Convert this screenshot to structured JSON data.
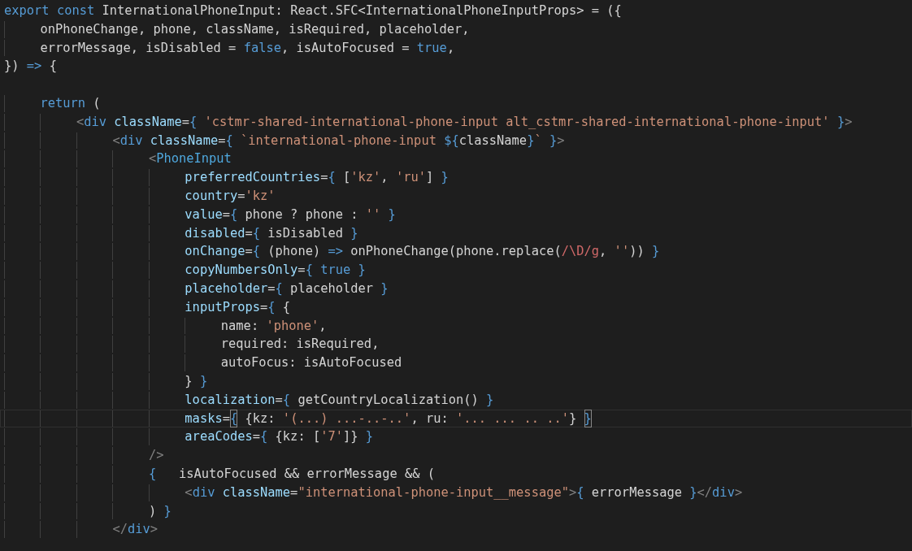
{
  "editor": {
    "lines": [
      {
        "current": false,
        "tokens": [
          {
            "kind": "keyword",
            "text": "export"
          },
          {
            "kind": "keyword",
            "text": " const"
          },
          {
            "kind": "plain",
            "text": " InternationalPhoneInput: React.SFC<InternationalPhoneInputProps> = ({"
          }
        ],
        "children": [
          {
            "current": false,
            "tokens": [
              {
                "kind": "plain",
                "text": "onPhoneChange, phone, className, isRequired, placeholder,"
              }
            ]
          },
          {
            "current": false,
            "tokens": [
              {
                "kind": "plain",
                "text": "errorMessage, isDisabled = "
              },
              {
                "kind": "keyword",
                "text": "false"
              },
              {
                "kind": "plain",
                "text": ", isAutoFocused = "
              },
              {
                "kind": "keyword",
                "text": "true"
              },
              {
                "kind": "plain",
                "text": ","
              }
            ]
          }
        ]
      },
      {
        "current": false,
        "tokens": [
          {
            "kind": "plain",
            "text": "}) "
          },
          {
            "kind": "keyword",
            "text": "=>"
          },
          {
            "kind": "plain",
            "text": " {"
          }
        ],
        "children": [
          {
            "current": false
          },
          {
            "current": false,
            "tokens": [
              {
                "kind": "keyword",
                "text": "return"
              },
              {
                "kind": "plain",
                "text": " ("
              }
            ],
            "children": [
              {
                "current": false,
                "tokens": [
                  {
                    "kind": "punct",
                    "text": "<"
                  },
                  {
                    "kind": "keyword",
                    "text": "div"
                  },
                  {
                    "kind": "attr",
                    "text": " className"
                  },
                  {
                    "kind": "plain",
                    "text": "="
                  },
                  {
                    "kind": "brace",
                    "text": "{"
                  },
                  {
                    "kind": "string",
                    "text": " 'cstmr-shared-international-phone-input alt_cstmr-shared-international-phone-input'"
                  },
                  {
                    "kind": "brace",
                    "text": " }"
                  },
                  {
                    "kind": "punct",
                    "text": ">"
                  }
                ],
                "children": [
                  {
                    "current": false,
                    "tokens": [
                      {
                        "kind": "punct",
                        "text": "<"
                      },
                      {
                        "kind": "keyword",
                        "text": "div"
                      },
                      {
                        "kind": "attr",
                        "text": " className"
                      },
                      {
                        "kind": "plain",
                        "text": "="
                      },
                      {
                        "kind": "brace",
                        "text": "{"
                      },
                      {
                        "kind": "string",
                        "text": " `international-phone-input "
                      },
                      {
                        "kind": "brace",
                        "text": "${"
                      },
                      {
                        "kind": "plain",
                        "text": "className"
                      },
                      {
                        "kind": "brace",
                        "text": "}"
                      },
                      {
                        "kind": "string",
                        "text": "`"
                      },
                      {
                        "kind": "brace",
                        "text": " }"
                      },
                      {
                        "kind": "punct",
                        "text": ">"
                      }
                    ],
                    "children": [
                      {
                        "current": false,
                        "tokens": [
                          {
                            "kind": "punct",
                            "text": "<"
                          },
                          {
                            "kind": "component",
                            "text": "PhoneInput"
                          }
                        ],
                        "children": [
                          {
                            "current": false,
                            "tokens": [
                              {
                                "kind": "attr",
                                "text": "preferredCountries"
                              },
                              {
                                "kind": "plain",
                                "text": "="
                              },
                              {
                                "kind": "brace",
                                "text": "{"
                              },
                              {
                                "kind": "plain",
                                "text": " ["
                              },
                              {
                                "kind": "string",
                                "text": "'kz'"
                              },
                              {
                                "kind": "plain",
                                "text": ", "
                              },
                              {
                                "kind": "string",
                                "text": "'ru'"
                              },
                              {
                                "kind": "plain",
                                "text": "]"
                              },
                              {
                                "kind": "brace",
                                "text": " }"
                              }
                            ]
                          },
                          {
                            "current": false,
                            "tokens": [
                              {
                                "kind": "attr",
                                "text": "country"
                              },
                              {
                                "kind": "plain",
                                "text": "="
                              },
                              {
                                "kind": "string",
                                "text": "'kz'"
                              }
                            ]
                          },
                          {
                            "current": false,
                            "tokens": [
                              {
                                "kind": "attr",
                                "text": "value"
                              },
                              {
                                "kind": "plain",
                                "text": "="
                              },
                              {
                                "kind": "brace",
                                "text": "{"
                              },
                              {
                                "kind": "plain",
                                "text": " phone ? phone : "
                              },
                              {
                                "kind": "string",
                                "text": "''"
                              },
                              {
                                "kind": "brace",
                                "text": " }"
                              }
                            ]
                          },
                          {
                            "current": false,
                            "tokens": [
                              {
                                "kind": "attr",
                                "text": "disabled"
                              },
                              {
                                "kind": "plain",
                                "text": "="
                              },
                              {
                                "kind": "brace",
                                "text": "{"
                              },
                              {
                                "kind": "plain",
                                "text": " isDisabled"
                              },
                              {
                                "kind": "brace",
                                "text": " }"
                              }
                            ]
                          },
                          {
                            "current": false,
                            "tokens": [
                              {
                                "kind": "attr",
                                "text": "onChange"
                              },
                              {
                                "kind": "plain",
                                "text": "="
                              },
                              {
                                "kind": "brace",
                                "text": "{"
                              },
                              {
                                "kind": "plain",
                                "text": " (phone) "
                              },
                              {
                                "kind": "keyword",
                                "text": "=>"
                              },
                              {
                                "kind": "plain",
                                "text": " onPhoneChange(phone.replace("
                              },
                              {
                                "kind": "regex",
                                "text": "/\\D/g"
                              },
                              {
                                "kind": "plain",
                                "text": ", "
                              },
                              {
                                "kind": "string",
                                "text": "''"
                              },
                              {
                                "kind": "plain",
                                "text": "))"
                              },
                              {
                                "kind": "brace",
                                "text": " }"
                              }
                            ]
                          },
                          {
                            "current": false,
                            "tokens": [
                              {
                                "kind": "attr",
                                "text": "copyNumbersOnly"
                              },
                              {
                                "kind": "plain",
                                "text": "="
                              },
                              {
                                "kind": "brace",
                                "text": "{"
                              },
                              {
                                "kind": "keyword",
                                "text": " true"
                              },
                              {
                                "kind": "brace",
                                "text": " }"
                              }
                            ]
                          },
                          {
                            "current": false,
                            "tokens": [
                              {
                                "kind": "attr",
                                "text": "placeholder"
                              },
                              {
                                "kind": "plain",
                                "text": "="
                              },
                              {
                                "kind": "brace",
                                "text": "{"
                              },
                              {
                                "kind": "plain",
                                "text": " placeholder"
                              },
                              {
                                "kind": "brace",
                                "text": " }"
                              }
                            ]
                          },
                          {
                            "current": false,
                            "tokens": [
                              {
                                "kind": "attr",
                                "text": "inputProps"
                              },
                              {
                                "kind": "plain",
                                "text": "="
                              },
                              {
                                "kind": "brace",
                                "text": "{"
                              },
                              {
                                "kind": "plain",
                                "text": " {"
                              }
                            ],
                            "children": [
                              {
                                "current": false,
                                "tokens": [
                                  {
                                    "kind": "plain",
                                    "text": "name: "
                                  },
                                  {
                                    "kind": "string",
                                    "text": "'phone'"
                                  },
                                  {
                                    "kind": "plain",
                                    "text": ","
                                  }
                                ]
                              },
                              {
                                "current": false,
                                "tokens": [
                                  {
                                    "kind": "plain",
                                    "text": "required: isRequired,"
                                  }
                                ]
                              },
                              {
                                "current": false,
                                "tokens": [
                                  {
                                    "kind": "plain",
                                    "text": "autoFocus: isAutoFocused"
                                  }
                                ]
                              }
                            ]
                          },
                          {
                            "current": false,
                            "tokens": [
                              {
                                "kind": "plain",
                                "text": "}"
                              },
                              {
                                "kind": "brace",
                                "text": " }"
                              }
                            ]
                          },
                          {
                            "current": false,
                            "tokens": [
                              {
                                "kind": "attr",
                                "text": "localization"
                              },
                              {
                                "kind": "plain",
                                "text": "="
                              },
                              {
                                "kind": "brace",
                                "text": "{"
                              },
                              {
                                "kind": "plain",
                                "text": " getCountryLocalization()"
                              },
                              {
                                "kind": "brace",
                                "text": " }"
                              }
                            ]
                          },
                          {
                            "current": true,
                            "tokens": [
                              {
                                "kind": "attr",
                                "text": "masks"
                              },
                              {
                                "kind": "plain",
                                "text": "="
                              },
                              {
                                "kind": "match",
                                "text": "{"
                              },
                              {
                                "kind": "plain",
                                "text": " {kz: "
                              },
                              {
                                "kind": "string",
                                "text": "'(...) ...-..-..'"
                              },
                              {
                                "kind": "plain",
                                "text": ", ru: "
                              },
                              {
                                "kind": "string",
                                "text": "'... ... .. ..'"
                              },
                              {
                                "kind": "plain",
                                "text": "} "
                              },
                              {
                                "kind": "match",
                                "text": "}"
                              }
                            ]
                          },
                          {
                            "current": false,
                            "tokens": [
                              {
                                "kind": "attr",
                                "text": "areaCodes"
                              },
                              {
                                "kind": "plain",
                                "text": "="
                              },
                              {
                                "kind": "brace",
                                "text": "{"
                              },
                              {
                                "kind": "plain",
                                "text": " {kz: ["
                              },
                              {
                                "kind": "string",
                                "text": "'7'"
                              },
                              {
                                "kind": "plain",
                                "text": "]}"
                              },
                              {
                                "kind": "brace",
                                "text": " }"
                              }
                            ]
                          }
                        ]
                      },
                      {
                        "current": false,
                        "tokens": [
                          {
                            "kind": "punct",
                            "text": "/>"
                          }
                        ]
                      },
                      {
                        "current": false,
                        "tokens": [
                          {
                            "kind": "brace",
                            "text": "{"
                          },
                          {
                            "kind": "plain",
                            "text": "   isAutoFocused && errorMessage && ("
                          }
                        ],
                        "children": [
                          {
                            "current": false,
                            "tokens": [
                              {
                                "kind": "punct",
                                "text": "<"
                              },
                              {
                                "kind": "keyword",
                                "text": "div"
                              },
                              {
                                "kind": "attr",
                                "text": " className"
                              },
                              {
                                "kind": "plain",
                                "text": "="
                              },
                              {
                                "kind": "string",
                                "text": "\"international-phone-input__message\""
                              },
                              {
                                "kind": "punct",
                                "text": ">"
                              },
                              {
                                "kind": "brace",
                                "text": "{"
                              },
                              {
                                "kind": "plain",
                                "text": " errorMessage"
                              },
                              {
                                "kind": "brace",
                                "text": " }"
                              },
                              {
                                "kind": "punct",
                                "text": "</"
                              },
                              {
                                "kind": "keyword",
                                "text": "div"
                              },
                              {
                                "kind": "punct",
                                "text": ">"
                              }
                            ]
                          }
                        ]
                      },
                      {
                        "current": false,
                        "tokens": [
                          {
                            "kind": "plain",
                            "text": ")"
                          },
                          {
                            "kind": "brace",
                            "text": " }"
                          }
                        ]
                      }
                    ]
                  },
                  {
                    "current": false,
                    "tokens": [
                      {
                        "kind": "punct",
                        "text": "</"
                      },
                      {
                        "kind": "keyword",
                        "text": "div"
                      },
                      {
                        "kind": "punct",
                        "text": ">"
                      }
                    ]
                  }
                ]
              }
            ]
          }
        ]
      }
    ]
  }
}
